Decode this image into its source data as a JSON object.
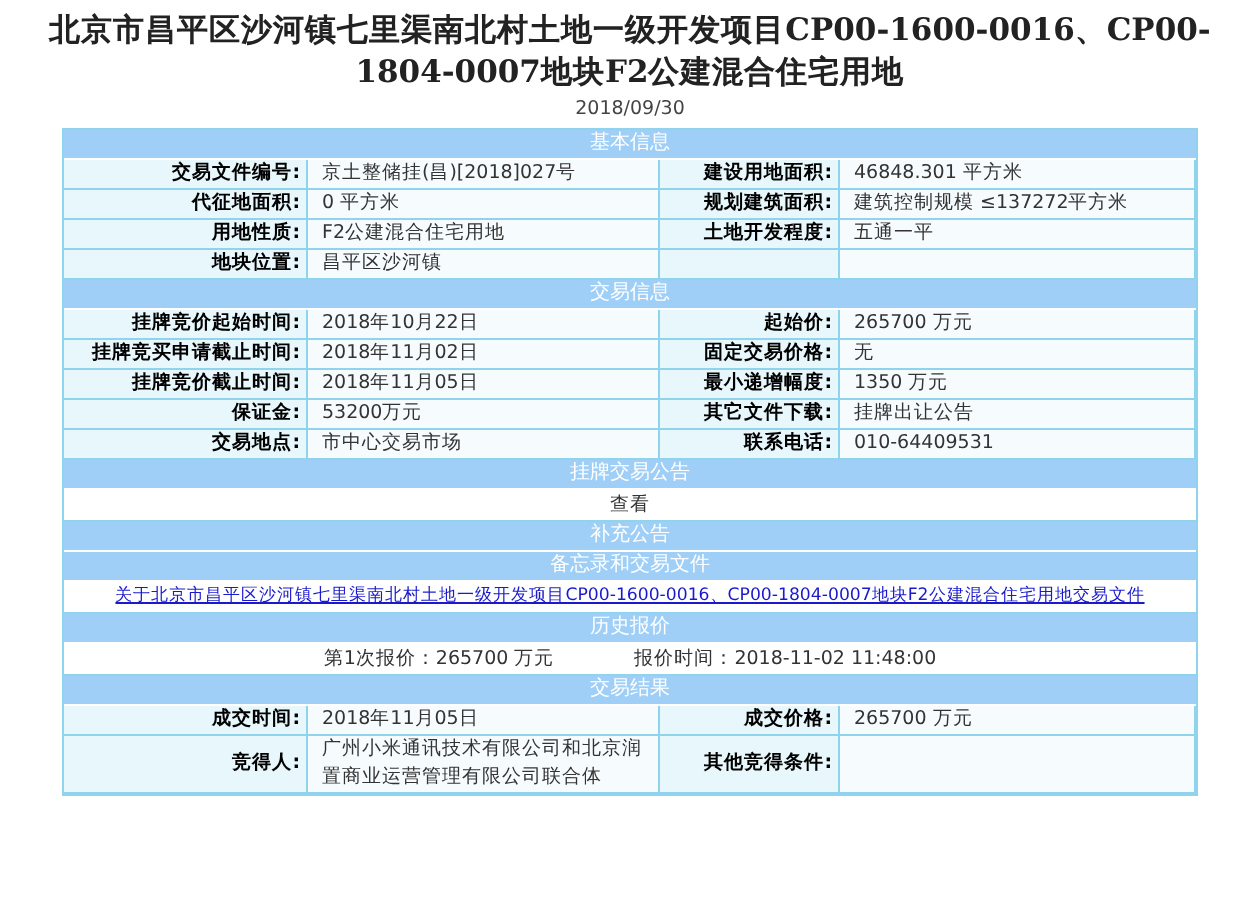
{
  "title": "北京市昌平区沙河镇七里渠南北村土地一级开发项目CP00-1600-0016、CP00-1804-0007地块F2公建混合住宅用地",
  "date": "2018/09/30",
  "sections": [
    {
      "kind": "fields",
      "heading": "基本信息",
      "rows": [
        {
          "pairs": [
            {
              "label": "交易文件编号:",
              "value": "京土整储挂(昌)[2018]027号"
            },
            {
              "label": "建设用地面积:",
              "value": "46848.301 平方米"
            }
          ]
        },
        {
          "pairs": [
            {
              "label": "代征地面积:",
              "value": "0 平方米"
            },
            {
              "label": "规划建筑面积:",
              "value": "建筑控制规模 ≤137272平方米"
            }
          ]
        },
        {
          "pairs": [
            {
              "label": "用地性质:",
              "value": "F2公建混合住宅用地"
            },
            {
              "label": "土地开发程度:",
              "value": "五通一平"
            }
          ]
        },
        {
          "pairs": [
            {
              "label": "地块位置:",
              "value": "昌平区沙河镇"
            }
          ]
        }
      ]
    },
    {
      "kind": "fields",
      "heading": "交易信息",
      "rows": [
        {
          "pairs": [
            {
              "label": "挂牌竞价起始时间:",
              "value": "2018年10月22日"
            },
            {
              "label": "起始价:",
              "value": "265700 万元"
            }
          ]
        },
        {
          "pairs": [
            {
              "label": "挂牌竞买申请截止时间:",
              "value": "2018年11月02日"
            },
            {
              "label": "固定交易价格:",
              "value": "无"
            }
          ]
        },
        {
          "pairs": [
            {
              "label": "挂牌竞价截止时间:",
              "value": "2018年11月05日"
            },
            {
              "label": "最小递增幅度:",
              "value": "1350 万元"
            }
          ]
        },
        {
          "pairs": [
            {
              "label": "保证金:",
              "value": "53200万元"
            },
            {
              "label": "其它文件下载:",
              "value": "挂牌出让公告"
            }
          ]
        },
        {
          "pairs": [
            {
              "label": "交易地点:",
              "value": "市中心交易市场"
            },
            {
              "label": "联系电话:",
              "value": "010-64409531"
            }
          ]
        }
      ]
    },
    {
      "kind": "text",
      "heading": "挂牌交易公告",
      "texts": [
        "查看"
      ]
    },
    {
      "kind": "none",
      "heading": "补充公告"
    },
    {
      "kind": "link",
      "heading": "备忘录和交易文件",
      "link": "关于北京市昌平区沙河镇七里渠南北村土地一级开发项目CP00-1600-0016、CP00-1804-0007地块F2公建混合住宅用地交易文件"
    },
    {
      "kind": "text",
      "heading": "历史报价",
      "texts": [
        "第1次报价：265700 万元",
        "报价时间：2018-11-02 11:48:00"
      ]
    },
    {
      "kind": "fields",
      "heading": "交易结果",
      "rows": [
        {
          "pairs": [
            {
              "label": "成交时间:",
              "value": "2018年11月05日"
            },
            {
              "label": "成交价格:",
              "value": "265700 万元"
            }
          ]
        },
        {
          "pairs": [
            {
              "label": "竞得人:",
              "value": "广州小米通讯技术有限公司和北京润置商业运营管理有限公司联合体"
            },
            {
              "label": "其他竞得条件:"
            }
          ]
        }
      ]
    }
  ]
}
